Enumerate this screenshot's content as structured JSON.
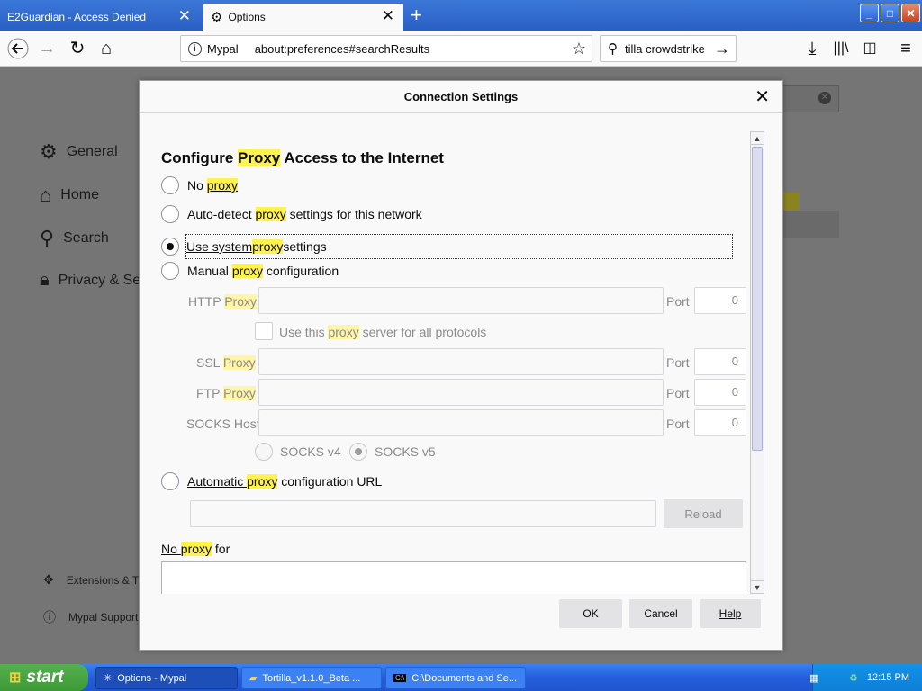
{
  "tabs": [
    {
      "label": "E2Guardian - Access Denied"
    },
    {
      "label": "Options"
    }
  ],
  "window_controls": {
    "minimize": "_",
    "maximize": "□",
    "close": "✕"
  },
  "navbar": {
    "site_name": "Mypal",
    "url": "about:preferences#searchResults",
    "search_value": "tilla crowdstrike"
  },
  "sidebar": {
    "items": [
      {
        "label": "General",
        "icon": "gear-icon"
      },
      {
        "label": "Home",
        "icon": "home-icon"
      },
      {
        "label": "Search",
        "icon": "search-icon"
      },
      {
        "label": "Privacy & Se",
        "icon": "lock-icon"
      }
    ],
    "bottom": [
      {
        "label": "Extensions & T",
        "icon": "puzzle-icon"
      },
      {
        "label": "Mypal Support",
        "icon": "help-icon"
      }
    ]
  },
  "dialog": {
    "title": "Connection Settings",
    "heading_pre": "Configure ",
    "heading_hl": "Proxy",
    "heading_post": " Access to the Internet",
    "options": {
      "no_proxy": {
        "pre": "No ",
        "hl": "proxy",
        "post": ""
      },
      "auto_detect": {
        "pre": "Auto-detect ",
        "hl": "proxy",
        "post": " settings for this network"
      },
      "system": {
        "pre": "Use system ",
        "hl": "proxy",
        "post": " settings"
      },
      "manual": {
        "pre": "Manual ",
        "hl": "proxy",
        "post": " configuration"
      },
      "auto_url": {
        "pre": "Automatic ",
        "hl": "proxy",
        "post": " configuration URL"
      }
    },
    "selected_option": "system",
    "http": {
      "pre": "HTTP ",
      "hl": "Proxy",
      "port_label": "Port",
      "port_value": "0"
    },
    "use_all": {
      "pre": "Use this ",
      "hl": "proxy",
      "post": " server for all protocols"
    },
    "ssl": {
      "pre": "SSL ",
      "hl": "Proxy",
      "port_label": "Port",
      "port_value": "0"
    },
    "ftp": {
      "pre": "FTP ",
      "hl": "Proxy",
      "port_label": "Port",
      "port_value": "0"
    },
    "socks": {
      "label": "SOCKS Host",
      "port_label": "Port",
      "port_value": "0"
    },
    "socks_v4": "SOCKS v4",
    "socks_v5": "SOCKS v5",
    "reload": "Reload",
    "no_proxy_for": {
      "pre": "No ",
      "hl": "proxy",
      "post": " for"
    },
    "buttons": {
      "ok": "OK",
      "cancel": "Cancel",
      "help": "Help"
    }
  },
  "taskbar": {
    "start": "start",
    "tasks": [
      {
        "label": "Options - Mypal"
      },
      {
        "label": "Tortilla_v1.1.0_Beta ..."
      },
      {
        "label": "C:\\Documents and Se..."
      }
    ],
    "clock": "12:15 PM"
  }
}
